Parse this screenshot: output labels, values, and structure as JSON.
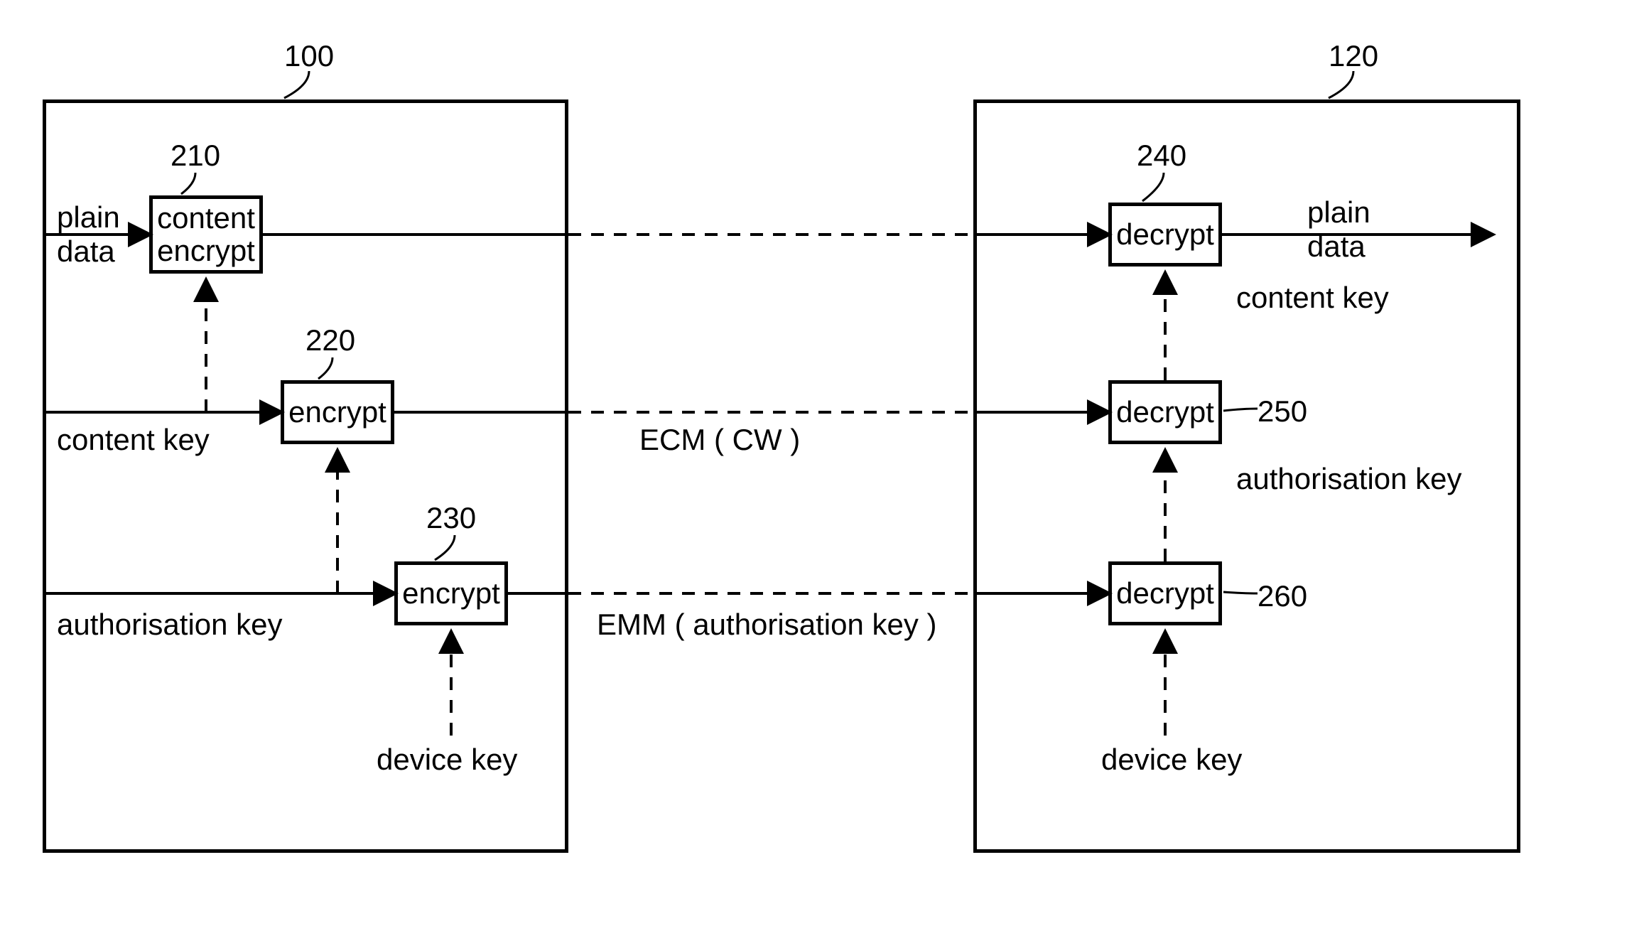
{
  "left_box_ref": "100",
  "right_box_ref": "120",
  "block210": {
    "ref": "210",
    "label": "content\nencrypt"
  },
  "block220": {
    "ref": "220",
    "label": "encrypt"
  },
  "block230": {
    "ref": "230",
    "label": "encrypt"
  },
  "block240": {
    "ref": "240",
    "label": "decrypt"
  },
  "block250": {
    "ref": "250",
    "label": "decrypt"
  },
  "block260": {
    "ref": "260",
    "label": "decrypt"
  },
  "labels": {
    "plain_data_in": "plain\ndata",
    "content_key_in": "content key",
    "authorisation_key_in": "authorisation key",
    "device_key_left": "device key",
    "ecm_cw": "ECM ( CW )",
    "emm_auth": "EMM ( authorisation key )",
    "plain_data_out": "plain\ndata",
    "content_key_right": "content key",
    "authorisation_key_right": "authorisation key",
    "device_key_right": "device key"
  }
}
